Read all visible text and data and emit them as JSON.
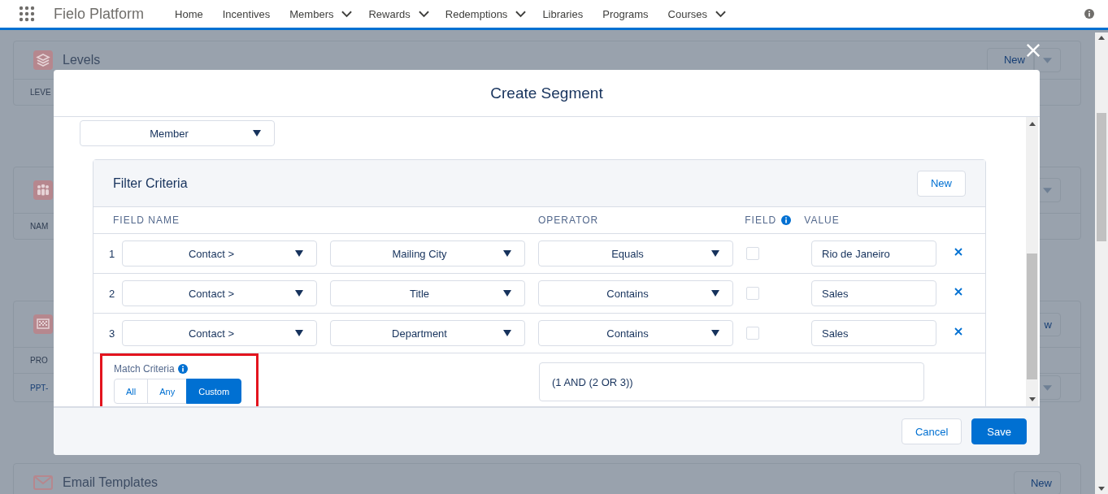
{
  "navbar": {
    "app_name": "Fielo Platform",
    "items": [
      {
        "label": "Home",
        "dropdown": false
      },
      {
        "label": "Incentives",
        "dropdown": false
      },
      {
        "label": "Members",
        "dropdown": true
      },
      {
        "label": "Rewards",
        "dropdown": true
      },
      {
        "label": "Redemptions",
        "dropdown": true
      },
      {
        "label": "Libraries",
        "dropdown": false
      },
      {
        "label": "Programs",
        "dropdown": false
      },
      {
        "label": "Courses",
        "dropdown": true
      }
    ]
  },
  "background_cards": [
    {
      "title": "Levels",
      "action": "New",
      "action_menu": true,
      "rows": [
        {
          "kind": "header",
          "text": "LEVE",
          "menu": false
        }
      ]
    },
    {
      "action_menu": true,
      "rows": [
        {
          "kind": "header",
          "text": "NAM",
          "menu": false
        }
      ]
    },
    {
      "action": "w",
      "action_menu": false,
      "rows": [
        {
          "kind": "header",
          "text": "PRO",
          "menu": false
        },
        {
          "kind": "link",
          "text": "PPT-",
          "menu": true
        }
      ]
    },
    {
      "title": "Email Templates",
      "action": "New",
      "action_menu": false
    }
  ],
  "modal": {
    "title": "Create Segment",
    "object_select": "Member",
    "filter": {
      "title": "Filter Criteria",
      "new_button": "New",
      "columns": {
        "field_name": "FIELD NAME",
        "operator": "OPERATOR",
        "field": "FIELD",
        "value": "VALUE"
      },
      "rows": [
        {
          "number": "1",
          "object": "Contact >",
          "field": "Mailing City",
          "operator": "Equals",
          "field_ref": false,
          "value": "Rio de Janeiro"
        },
        {
          "number": "2",
          "object": "Contact >",
          "field": "Title",
          "operator": "Contains",
          "field_ref": false,
          "value": "Sales"
        },
        {
          "number": "3",
          "object": "Contact >",
          "field": "Department",
          "operator": "Contains",
          "field_ref": false,
          "value": "Sales"
        }
      ],
      "match": {
        "label": "Match Criteria",
        "highlighted": true,
        "options": [
          {
            "label": "All",
            "selected": false
          },
          {
            "label": "Any",
            "selected": false
          },
          {
            "label": "Custom",
            "selected": true
          }
        ],
        "expression": "(1 AND (2 OR 3))"
      }
    },
    "buttons": [
      {
        "label": "Cancel",
        "kind": "neutral"
      },
      {
        "label": "Save",
        "kind": "brand"
      }
    ]
  }
}
